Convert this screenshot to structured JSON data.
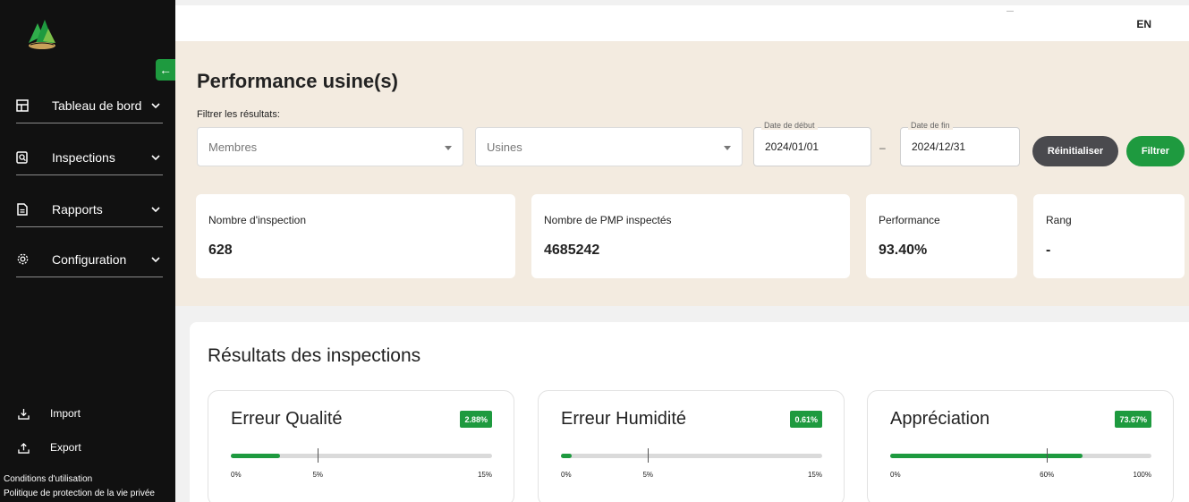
{
  "app": {
    "lang_toggle": "EN",
    "page_title": "Performance usine(s)"
  },
  "sidebar": {
    "items": [
      {
        "label": "Tableau de bord",
        "icon": "dashboard-icon"
      },
      {
        "label": "Inspections",
        "icon": "inspection-search-icon"
      },
      {
        "label": "Rapports",
        "icon": "report-document-icon"
      },
      {
        "label": "Configuration",
        "icon": "gear-icon"
      }
    ],
    "bottom": [
      {
        "label": "Import",
        "icon": "download-tray-icon"
      },
      {
        "label": "Export",
        "icon": "upload-tray-icon"
      }
    ],
    "links": [
      "Conditions d'utilisation",
      "Politique de protection de la vie privée"
    ]
  },
  "filters": {
    "label": "Filtrer les résultats:",
    "members_placeholder": "Membres",
    "plants_placeholder": "Usines",
    "start_label": "Date de début",
    "start_value": "2024/01/01",
    "end_label": "Date de fin",
    "end_value": "2024/12/31",
    "separator": "–",
    "reset_label": "Réinitialiser",
    "filter_label": "Filtrer"
  },
  "stats": [
    {
      "label": "Nombre d'inspection",
      "value": "628"
    },
    {
      "label": "Nombre de PMP inspectés",
      "value": "4685242"
    },
    {
      "label": "Performance",
      "value": "93.40%"
    },
    {
      "label": "Rang",
      "value": "-"
    }
  ],
  "results": {
    "title": "Résultats des inspections",
    "cards": [
      {
        "title": "Erreur Qualité",
        "badge": "2.88%",
        "fill_fraction": 0.19,
        "ticks": [
          {
            "label": "0%",
            "pos": 0
          },
          {
            "label": "5%",
            "pos": 0.333
          },
          {
            "label": "15%",
            "pos": 1
          }
        ],
        "marker": 0.333
      },
      {
        "title": "Erreur Humidité",
        "badge": "0.61%",
        "fill_fraction": 0.04,
        "ticks": [
          {
            "label": "0%",
            "pos": 0
          },
          {
            "label": "5%",
            "pos": 0.333
          },
          {
            "label": "15%",
            "pos": 1
          }
        ],
        "marker": 0.333
      },
      {
        "title": "Appréciation",
        "badge": "73.67%",
        "fill_fraction": 0.7367,
        "ticks": [
          {
            "label": "0%",
            "pos": 0
          },
          {
            "label": "60%",
            "pos": 0.6
          },
          {
            "label": "100%",
            "pos": 1
          }
        ],
        "marker": 0.6
      }
    ]
  },
  "colors": {
    "accent": "#1e9a3f",
    "sidebar_bg": "#111111",
    "panel_bg": "#f3ebe0",
    "reset_btn": "#4a4a4e"
  }
}
